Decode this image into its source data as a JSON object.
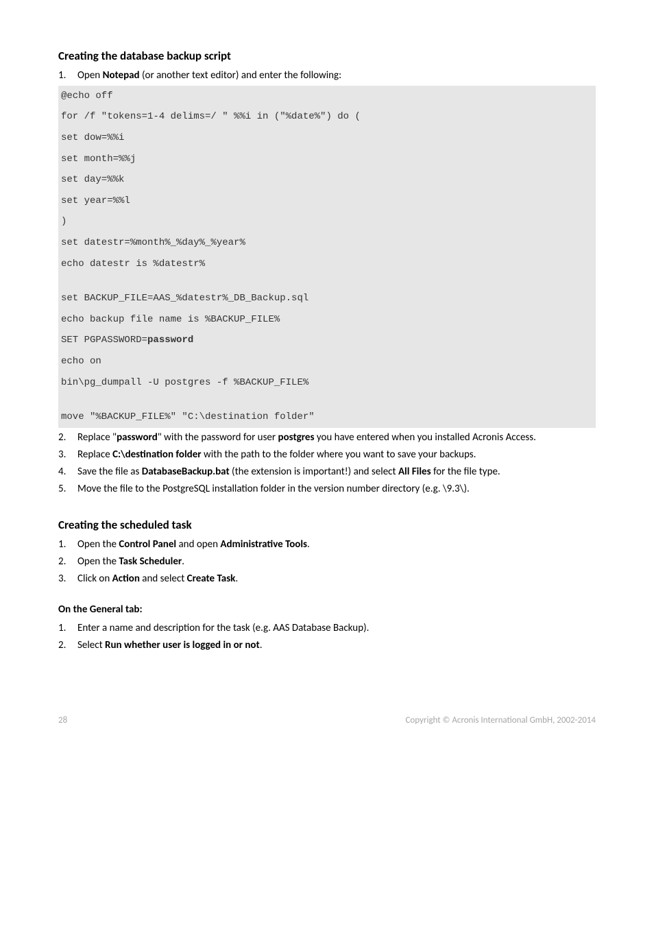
{
  "section1": {
    "title": "Creating the database backup script",
    "step1_num": "1.",
    "step1_a": "Open ",
    "step1_b": "Notepad",
    "step1_c": " (or another text editor) and enter the following:",
    "code": {
      "l1": "@echo off",
      "l2": "for /f \"tokens=1-4 delims=/ \" %%i in (\"%date%\") do (",
      "l3": "set dow=%%i",
      "l4": "set month=%%j",
      "l5": "set day=%%k",
      "l6": "set year=%%l",
      "l7": ")",
      "l8": "set datestr=%month%_%day%_%year%",
      "l9": "echo datestr is %datestr%",
      "l10": "set BACKUP_FILE=AAS_%datestr%_DB_Backup.sql",
      "l11": "echo backup file name is %BACKUP_FILE%",
      "l12a": "SET PGPASSWORD=",
      "l12b": "password",
      "l13": "echo on",
      "l14": "bin\\pg_dumpall -U postgres -f %BACKUP_FILE%",
      "l15": "move \"%BACKUP_FILE%\" \"C:\\destination folder\""
    },
    "step2_num": "2.",
    "step2_a": "Replace \"",
    "step2_b": "password",
    "step2_c": "\" with the password for user ",
    "step2_d": "postgres",
    "step2_e": " you have entered when you installed Acronis Access.",
    "step3_num": "3.",
    "step3_a": "Replace ",
    "step3_b": "C:\\destination folder",
    "step3_c": " with the path to the folder where you want to save your backups.",
    "step4_num": "4.",
    "step4_a": "Save the file as ",
    "step4_b": "DatabaseBackup.bat",
    "step4_c": " (the extension is important!) and select ",
    "step4_d": "All Files",
    "step4_e": " for the file type.",
    "step5_num": "5.",
    "step5_a": "Move the file to the PostgreSQL installation folder in the version number directory (e.g. \\9.3\\)."
  },
  "section2": {
    "title": "Creating the scheduled task",
    "s1_num": "1.",
    "s1_a": "Open the ",
    "s1_b": "Control Panel",
    "s1_c": " and open ",
    "s1_d": "Administrative Tools",
    "s1_e": ".",
    "s2_num": "2.",
    "s2_a": "Open the ",
    "s2_b": "Task Scheduler",
    "s2_c": ".",
    "s3_num": "3.",
    "s3_a": "Click on ",
    "s3_b": "Action",
    "s3_c": " and select ",
    "s3_d": "Create Task",
    "s3_e": "."
  },
  "section3": {
    "title": "On the General tab:",
    "g1_num": "1.",
    "g1_a": "Enter a name and description for the task (e.g. AAS Database Backup).",
    "g2_num": "2.",
    "g2_a": "Select ",
    "g2_b": "Run whether user is logged in or not",
    "g2_c": "."
  },
  "footer": {
    "page": "28",
    "copyright": "Copyright © Acronis International GmbH, 2002-2014"
  }
}
